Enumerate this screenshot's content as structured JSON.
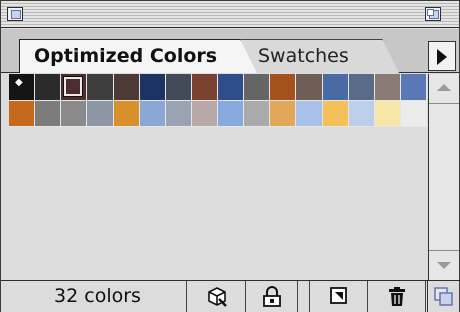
{
  "tabs": [
    {
      "label": "Optimized Colors",
      "active": true
    },
    {
      "label": "Swatches",
      "active": false
    }
  ],
  "swatches": [
    "#141414",
    "#2b2b2b",
    "#4a2d2d",
    "#3e3e3e",
    "#4e3a34",
    "#1c3462",
    "#434b5b",
    "#7a4030",
    "#2d4d8b",
    "#656565",
    "#a4511e",
    "#6e5e56",
    "#4a6aa6",
    "#596b88",
    "#8a7a74",
    "#5a78b6",
    "#c56a1c",
    "#7c7c7c",
    "#8a8a8a",
    "#8d96a5",
    "#d8902c",
    "#8aa7d6",
    "#9aa3b4",
    "#b7a9a7",
    "#88a9dd",
    "#aaaaaa",
    "#e2a85a",
    "#a8c0e8",
    "#f3c05a",
    "#bccfe9",
    "#f6e6a8",
    "#ececec"
  ],
  "selected_index": 2,
  "marked_index": 0,
  "status": {
    "count_label": "32 colors"
  },
  "icons": {
    "close": "close-box-icon",
    "zoom": "zoom-box-icon",
    "menu": "panel-menu-arrow-icon",
    "web_snap": "web-snap-cube-icon",
    "lock": "lock-icon",
    "new_swatch": "new-swatch-icon",
    "delete": "trash-icon",
    "resize": "resize-grip-icon"
  }
}
